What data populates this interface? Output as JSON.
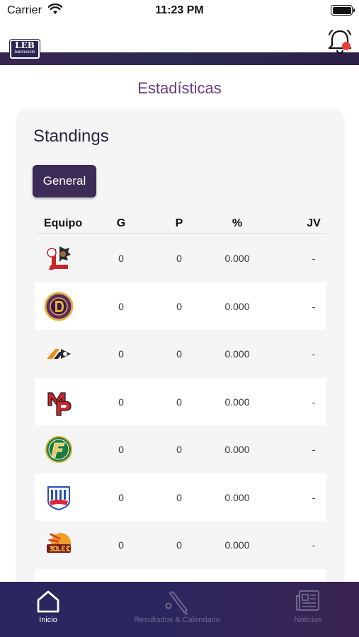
{
  "status": {
    "carrier": "Carrier",
    "time": "11:23 PM"
  },
  "header": {
    "logo": {
      "main": "LEB",
      "sub": "baloncesto"
    },
    "bell_icon": "bell-icon",
    "notification_color": "#e8413c"
  },
  "page_title": "Estadísticas",
  "standings": {
    "title": "Standings",
    "filter_label": "General",
    "columns": [
      "Equipo",
      "G",
      "P",
      "%",
      "JV"
    ],
    "rows": [
      {
        "logo": "team-logo-1",
        "g": "0",
        "p": "0",
        "pct": "0.000",
        "jv": "-"
      },
      {
        "logo": "team-logo-2",
        "g": "0",
        "p": "0",
        "pct": "0.000",
        "jv": "-"
      },
      {
        "logo": "team-logo-3",
        "g": "0",
        "p": "0",
        "pct": "0.000",
        "jv": "-"
      },
      {
        "logo": "team-logo-4",
        "g": "0",
        "p": "0",
        "pct": "0.000",
        "jv": "-"
      },
      {
        "logo": "team-logo-5",
        "g": "0",
        "p": "0",
        "pct": "0.000",
        "jv": "-"
      },
      {
        "logo": "team-logo-6",
        "g": "0",
        "p": "0",
        "pct": "0.000",
        "jv": "-"
      },
      {
        "logo": "team-logo-7",
        "g": "0",
        "p": "0",
        "pct": "0.000",
        "jv": "-"
      }
    ]
  },
  "tabbar": {
    "tabs": [
      {
        "label": "Inicio",
        "icon": "home-icon",
        "active": true
      },
      {
        "label": "Resultados & Calendario",
        "icon": "bat-icon",
        "active": false
      },
      {
        "label": "Noticias",
        "icon": "news-icon",
        "active": false
      }
    ],
    "active_color": "#ffffff",
    "inactive_color": "#6e6890"
  },
  "colors": {
    "accent": "#3b2d58",
    "title": "#6b3a82"
  }
}
